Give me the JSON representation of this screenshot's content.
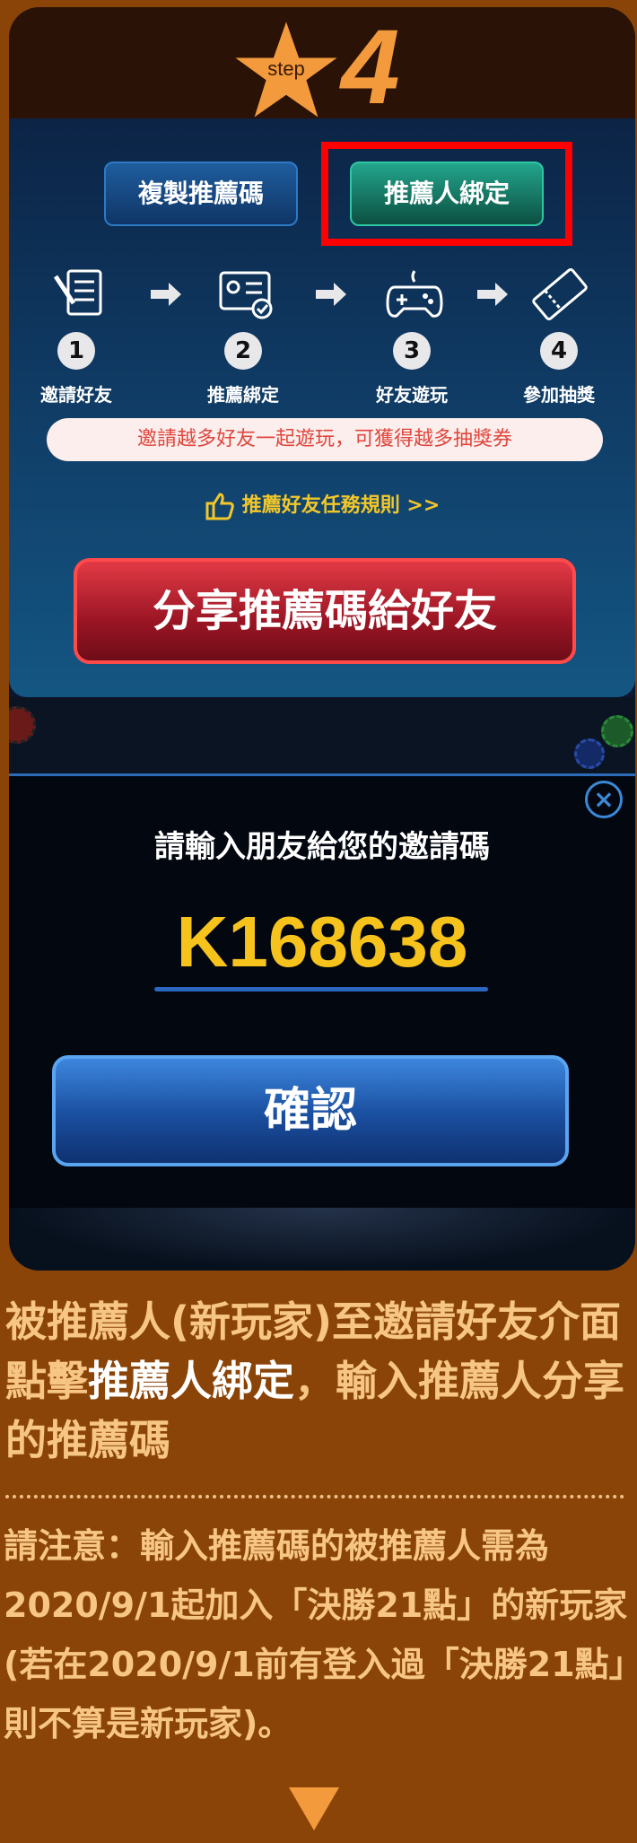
{
  "header": {
    "step_label": "step",
    "step_number": "4"
  },
  "buttons": {
    "copy_code": "複製推薦碼",
    "bind_referrer": "推薦人綁定",
    "share": "分享推薦碼給好友"
  },
  "steps": [
    {
      "num": "1",
      "label": "邀請好友",
      "icon": "document-pen-icon"
    },
    {
      "num": "2",
      "label": "推薦綁定",
      "icon": "id-card-check-icon"
    },
    {
      "num": "3",
      "label": "好友遊玩",
      "icon": "gamepad-icon"
    },
    {
      "num": "4",
      "label": "參加抽獎",
      "icon": "ticket-icon"
    }
  ],
  "banner": "邀請越多好友一起遊玩，可獲得越多抽獎券",
  "rules_link": "推薦好友任務規則 >>",
  "dialog": {
    "title": "請輸入朋友給您的邀請碼",
    "code": "K168638",
    "confirm": "確認",
    "close": "×"
  },
  "description": {
    "part1": "被推薦人(新玩家)至邀請好友介面點擊",
    "highlight": "推薦人綁定",
    "part2": "，輸入推薦人分享的推薦碼"
  },
  "note": "請注意：輸入推薦碼的被推薦人需為2020/9/1起加入「決勝21點」的新玩家(若在2020/9/1前有登入過「決勝21點」則不算是新玩家)。",
  "colors": {
    "background": "#8a4408",
    "accent_orange": "#f29a3c",
    "highlight_box": "#ff0000",
    "code_yellow": "#f6c21c"
  }
}
